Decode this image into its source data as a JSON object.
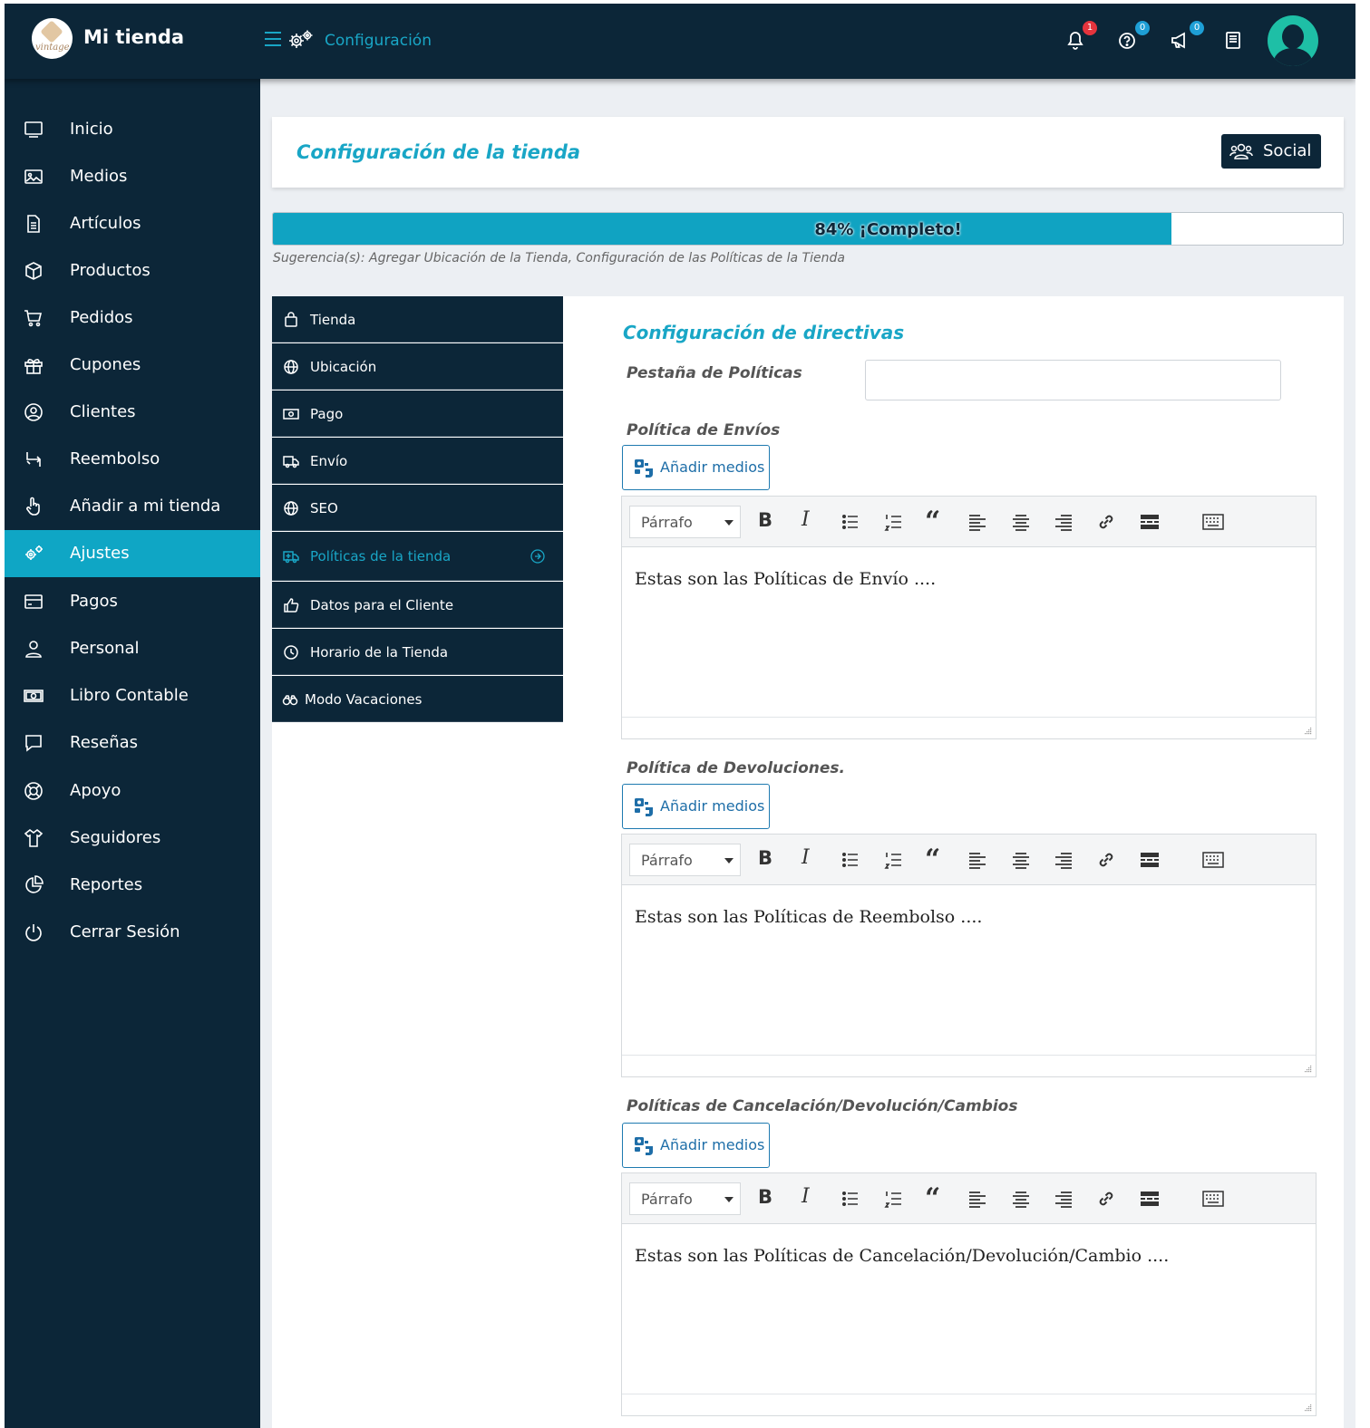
{
  "app": {
    "store_name": "Mi tienda",
    "breadcrumb": "Configuración"
  },
  "topbar": {
    "notifications": {
      "icon": "bell-icon",
      "count": "1"
    },
    "help": {
      "icon": "help-icon",
      "count": "0"
    },
    "announcements": {
      "icon": "megaphone-icon",
      "count": "0"
    },
    "docs": {
      "icon": "book-icon"
    }
  },
  "sidebar": {
    "items": [
      {
        "label": "Inicio",
        "icon": "monitor-icon"
      },
      {
        "label": "Medios",
        "icon": "image-icon"
      },
      {
        "label": "Artículos",
        "icon": "document-icon"
      },
      {
        "label": "Productos",
        "icon": "box-icon"
      },
      {
        "label": "Pedidos",
        "icon": "cart-icon"
      },
      {
        "label": "Cupones",
        "icon": "gift-icon"
      },
      {
        "label": "Clientes",
        "icon": "user-circle-icon"
      },
      {
        "label": "Reembolso",
        "icon": "refund-icon"
      },
      {
        "label": "Añadir a mi tienda",
        "icon": "hand-pointer-icon"
      },
      {
        "label": "Ajustes",
        "icon": "gears-icon",
        "active": true
      },
      {
        "label": "Pagos",
        "icon": "credit-card-icon"
      },
      {
        "label": "Personal",
        "icon": "person-icon"
      },
      {
        "label": "Libro Contable",
        "icon": "money-icon"
      },
      {
        "label": "Reseñas",
        "icon": "comment-icon"
      },
      {
        "label": "Apoyo",
        "icon": "lifebuoy-icon"
      },
      {
        "label": "Seguidores",
        "icon": "shirt-icon"
      },
      {
        "label": "Reportes",
        "icon": "pie-chart-icon"
      },
      {
        "label": "Cerrar Sesión",
        "icon": "power-icon"
      }
    ]
  },
  "header": {
    "title": "Configuración de la tienda",
    "social_button": "Social"
  },
  "progress": {
    "percent": 84,
    "label": "84% ¡Completo!",
    "suggestion": "Sugerencia(s): Agregar Ubicación de la Tienda, Configuración de las Políticas de la Tienda"
  },
  "tabs": [
    {
      "label": "Tienda",
      "icon": "bag-icon"
    },
    {
      "label": "Ubicación",
      "icon": "globe-icon"
    },
    {
      "label": "Pago",
      "icon": "money-icon"
    },
    {
      "label": "Envío",
      "icon": "truck-icon"
    },
    {
      "label": "SEO",
      "icon": "globe-icon"
    },
    {
      "label": "Políticas de la tienda",
      "icon": "ambulance-icon",
      "active": true
    },
    {
      "label": "Datos para el Cliente",
      "icon": "thumbs-up-icon"
    },
    {
      "label": "Horario de la Tienda",
      "icon": "clock-icon"
    },
    {
      "label": "Modo Vacaciones",
      "icon": "binoculars-icon"
    }
  ],
  "form": {
    "title": "Configuración de directivas",
    "policy_tab_label": "Pestaña de Políticas",
    "policy_tab_value": "",
    "sections": [
      {
        "label": "Política de Envíos",
        "media_button": "Añadir medios",
        "format": "Párrafo",
        "content": "Estas son las Políticas de Envío ...."
      },
      {
        "label": "Política de Devoluciones.",
        "media_button": "Añadir medios",
        "format": "Párrafo",
        "content": "Estas son las Políticas de Reembolso ...."
      },
      {
        "label": "Políticas de Cancelación/Devolución/Cambios",
        "media_button": "Añadir medios",
        "format": "Párrafo",
        "content": "Estas son las Políticas de Cancelación/Devolución/Cambio ...."
      }
    ]
  },
  "colors": {
    "navy": "#0c2638",
    "accent": "#0fa6c5",
    "badge_red": "#e5343d",
    "badge_blue": "#1e9fd6"
  }
}
